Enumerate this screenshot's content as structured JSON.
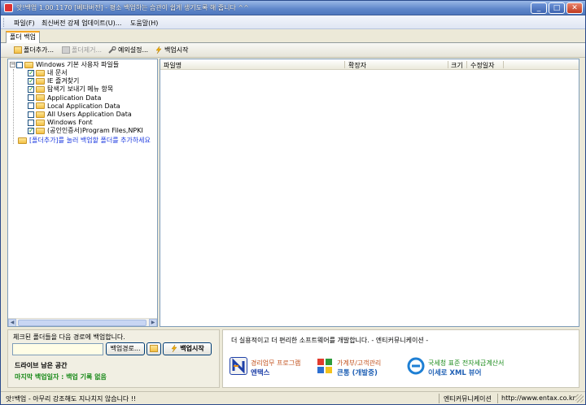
{
  "window": {
    "title": "앗!백업 1.00.1170 [베타버전] - 평소 백업하는 습관이 쉽게 생기도록 해 줍니다 ^^",
    "minimize": "_",
    "maximize": "□",
    "close": "✕"
  },
  "menu": [
    {
      "label": "파일(F)"
    },
    {
      "label": "최신버전 강제 업데이트(U)..."
    },
    {
      "label": "도움말(H)"
    }
  ],
  "tabs": [
    {
      "label": "폴더 백업",
      "active": true
    }
  ],
  "toolbar": {
    "add_folder": "폴더추가...",
    "remove_folder": "폴더제거...",
    "exclude_settings": "예외설정...",
    "start_backup": "백업시작"
  },
  "tree": {
    "root": "Windows 기본 사용자 파일들",
    "items": [
      {
        "label": "내 문서",
        "checked": true
      },
      {
        "label": "IE 즐겨찾기",
        "checked": true
      },
      {
        "label": "탐색기 보내기 메뉴 항목",
        "checked": true
      },
      {
        "label": "Application Data",
        "checked": false
      },
      {
        "label": "Local Application Data",
        "checked": false
      },
      {
        "label": "All Users Application Data",
        "checked": false
      },
      {
        "label": "Windows Font",
        "checked": false
      },
      {
        "label": "(공인인증서)Program Files,NPKI",
        "checked": true
      }
    ],
    "add_hint": "[폴더추가]를 눌러 백업할 폴더를 추가하세요"
  },
  "file_list": {
    "columns": [
      "파일명",
      "확장자",
      "크기",
      "수정일자"
    ]
  },
  "backup": {
    "label": "체크된 폴더들을 다음 경로에 백업합니다.",
    "path_value": "",
    "path_button": "백업경로...",
    "start_button": "백업시작",
    "drive_space_label": "드라이브 남은 공간",
    "last_backup": "마지막 백업일자 : 백업 기록 없음"
  },
  "ad": {
    "headline": "더 실용적이고 더 편리한 소프트웨어를 개발합니다.  - 엔티커뮤니케이션 -",
    "products": [
      {
        "sub": "경리업무 프로그램",
        "name": "엔택스",
        "color": "#1e40a8"
      },
      {
        "sub": "가계부/고객관리",
        "name": "큰통 (개발중)",
        "color": "#c2511d"
      },
      {
        "sub": "국세청 표준 전자세금계산서",
        "name": "이세로 XML 뷰어",
        "color": "#1e5fb4"
      }
    ]
  },
  "status": {
    "message": "앗!백업 - 아무리 강조해도 지나치지 않습니다 !!",
    "company": "엔티커뮤니케이션",
    "url": "http://www.entax.co.kr"
  },
  "colors": {
    "title_bar": "#4f78bd",
    "tree_link": "#1f3ce0",
    "last_backup": "#1b8b1b"
  }
}
